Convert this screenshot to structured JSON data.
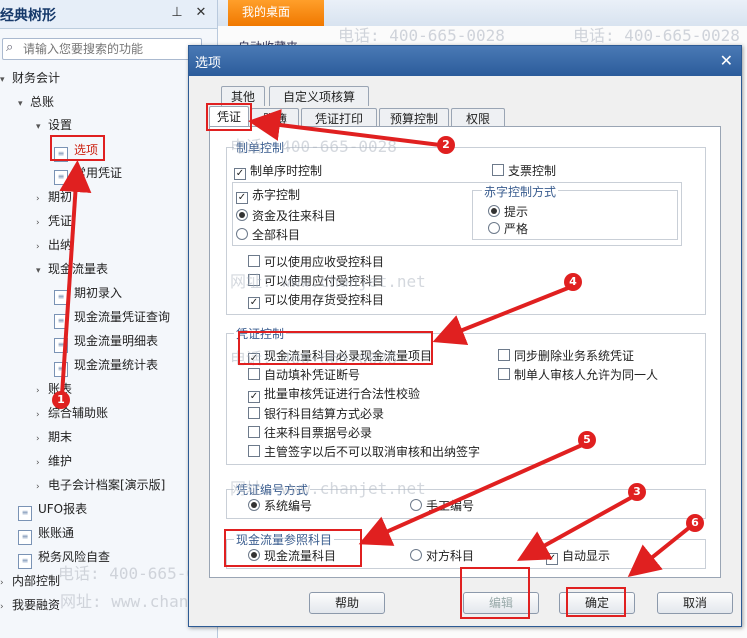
{
  "sidebar": {
    "title": "经典树形",
    "pin_icon": "pin-icon",
    "close_icon": "close-icon",
    "search_placeholder": "请输入您要搜索的功能",
    "items": [
      {
        "label": "财务会计",
        "arrow": "▾"
      },
      {
        "label": "总账",
        "arrow": "▾"
      },
      {
        "label": "设置",
        "arrow": "▾"
      },
      {
        "label": "选项"
      },
      {
        "label": "常用凭证"
      },
      {
        "label": "期初",
        "arrow": "›"
      },
      {
        "label": "凭证",
        "arrow": "›"
      },
      {
        "label": "出纳",
        "arrow": "›"
      },
      {
        "label": "现金流量表",
        "arrow": "▾"
      },
      {
        "label": "期初录入"
      },
      {
        "label": "现金流量凭证查询"
      },
      {
        "label": "现金流量明细表"
      },
      {
        "label": "现金流量统计表"
      },
      {
        "label": "账表",
        "arrow": "›"
      },
      {
        "label": "综合辅助账",
        "arrow": "›"
      },
      {
        "label": "期末",
        "arrow": "›"
      },
      {
        "label": "维护",
        "arrow": "›"
      },
      {
        "label": "电子会计档案[演示版]",
        "arrow": "›"
      },
      {
        "label": "UFO报表"
      },
      {
        "label": "账账通"
      },
      {
        "label": "税务风险自查"
      },
      {
        "label": "内部控制",
        "arrow": "›"
      },
      {
        "label": "我要融资",
        "arrow": "›"
      }
    ]
  },
  "desktop": {
    "tab_label": "我的桌面",
    "favorites_label": "自动收藏夹",
    "watermark_phone": "电话: 400-665-0028",
    "watermark_url": "网址: www.chanjet.net"
  },
  "dialog": {
    "title": "选项",
    "close_glyph": "✕",
    "tabs_row1": [
      "其他",
      "自定义项核算"
    ],
    "tabs_row2": [
      "凭证",
      "账簿",
      "凭证打印",
      "预算控制",
      "权限"
    ],
    "active_tab": "凭证",
    "group_make": {
      "label": "制单控制",
      "opt_timeorder": "制单序时控制",
      "opt_cheque": "支票控制",
      "opt_red": "赤字控制",
      "red_mode_label": "赤字控制方式",
      "red_mode_prompt": "提示",
      "red_mode_strict": "严格",
      "scope_funds": "资金及往来科目",
      "scope_all": "全部科目",
      "opt_ar": "可以使用应收受控科目",
      "opt_ap": "可以使用应付受控科目",
      "opt_inv": "可以使用存货受控科目"
    },
    "group_voucher": {
      "label": "凭证控制",
      "opt_cashflow_required": "现金流量科目必录现金流量项目",
      "opt_sync_delete": "同步删除业务系统凭证",
      "opt_fill_gap": "自动填补凭证断号",
      "opt_same_person": "制单人审核人允许为同一人",
      "opt_batch_audit": "批量审核凭证进行合法性校验",
      "opt_bank_settle": "银行科目结算方式必录",
      "opt_bill_no": "往来科目票据号必录",
      "opt_sign": "主管签字以后不可以取消审核和出纳签字"
    },
    "group_numbering": {
      "label": "凭证编号方式",
      "system": "系统编号",
      "manual": "手工编号"
    },
    "group_cashref": {
      "label": "现金流量参照科目",
      "cash_subject": "现金流量科目",
      "counter_subject": "对方科目",
      "auto_show": "自动显示"
    },
    "buttons": {
      "help": "帮助",
      "edit": "编辑",
      "ok": "确定",
      "cancel": "取消"
    }
  },
  "annotations": {
    "badges": [
      "1",
      "2",
      "3",
      "4",
      "5",
      "6"
    ],
    "color": "#e02020"
  }
}
